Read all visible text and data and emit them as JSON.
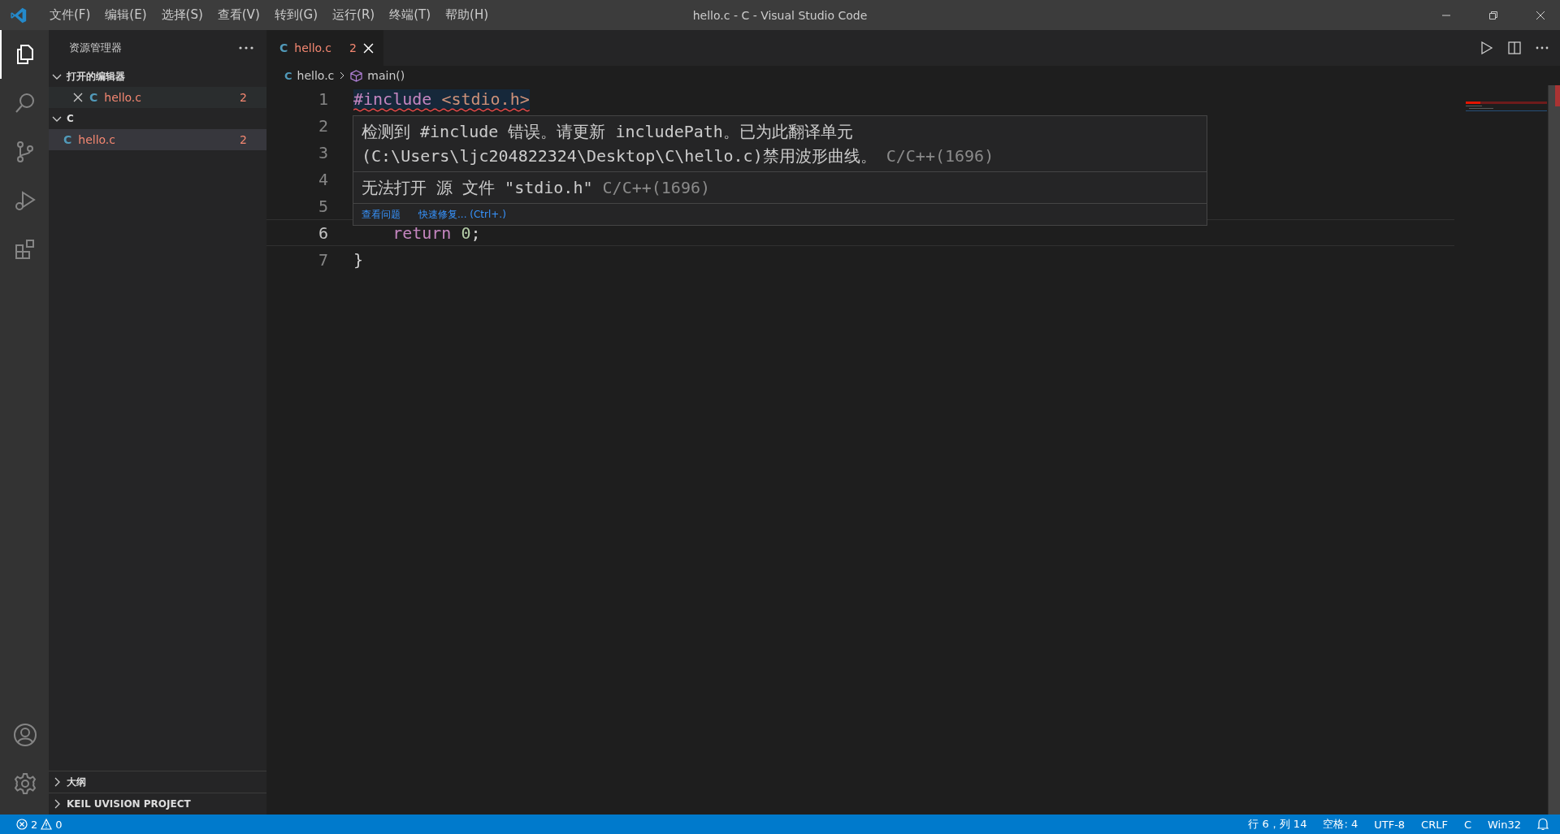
{
  "title_bar": {
    "menu": [
      "文件(F)",
      "编辑(E)",
      "选择(S)",
      "查看(V)",
      "转到(G)",
      "运行(R)",
      "终端(T)",
      "帮助(H)"
    ],
    "title": "hello.c - C - Visual Studio Code"
  },
  "activity_bar": {
    "items": [
      {
        "kind": "explorer",
        "selected": true
      },
      {
        "kind": "search",
        "selected": false
      },
      {
        "kind": "source-control",
        "selected": false
      },
      {
        "kind": "run",
        "selected": false
      },
      {
        "kind": "extensions",
        "selected": false
      }
    ],
    "bottom": [
      {
        "kind": "account"
      },
      {
        "kind": "settings"
      }
    ]
  },
  "sidebar": {
    "title": "资源管理器",
    "sections": [
      {
        "title": "打开的编辑器",
        "expanded": true,
        "items": [
          {
            "icon": "C",
            "name": "hello.c",
            "badge": "2",
            "closable": true,
            "selected": false
          }
        ]
      },
      {
        "title": "C",
        "expanded": true,
        "items": [
          {
            "icon": "C",
            "name": "hello.c",
            "badge": "2",
            "closable": false,
            "selected": true
          }
        ]
      },
      {
        "title": "大纲",
        "expanded": false
      },
      {
        "title": "KEIL UVISION PROJECT",
        "expanded": false
      }
    ]
  },
  "tabs": [
    {
      "icon": "C",
      "name": "hello.c",
      "badge": "2",
      "selected": true
    }
  ],
  "breadcrumb": [
    {
      "icon": "C",
      "text": "hello.c"
    },
    {
      "text": "main()"
    }
  ],
  "editor": {
    "lines": [
      {
        "number": "1",
        "current": false,
        "error": true,
        "tokens": [
          {
            "kind": "keyword",
            "text": "#include "
          },
          {
            "kind": "string",
            "text": "<stdio.h>"
          }
        ]
      },
      {
        "number": "2",
        "current": false
      },
      {
        "number": "3",
        "current": false
      },
      {
        "number": "4",
        "current": false
      },
      {
        "number": "5",
        "current": false
      },
      {
        "number": "6",
        "current": true,
        "kind": "indented",
        "tokens": [
          {
            "kind": "keyword",
            "text": "return "
          },
          {
            "kind": "number",
            "text": "0"
          },
          {
            "kind": "plain",
            "text": ";"
          }
        ]
      },
      {
        "number": "7",
        "current": false,
        "tokens": [
          {
            "kind": "plain",
            "text": "}"
          }
        ]
      }
    ]
  },
  "hover": {
    "messages": [
      {
        "text": "检测到 #include 错误。请更新 includePath。已为此翻译单元 (C:\\Users\\ljc204822324\\Desktop\\C\\hello.c)禁用波形曲线。",
        "source": "C/C++(1696)"
      },
      {
        "text": "无法打开 源 文件 \"stdio.h\"",
        "source": "C/C++(1696)"
      }
    ],
    "actions": [
      "查看问题",
      "快速修复... (Ctrl+.)"
    ]
  },
  "status_bar": {
    "errors": "2",
    "warnings": "0",
    "items": [
      "行 6，列 14",
      "空格: 4",
      "UTF-8",
      "CRLF",
      "C",
      "Win32"
    ]
  }
}
